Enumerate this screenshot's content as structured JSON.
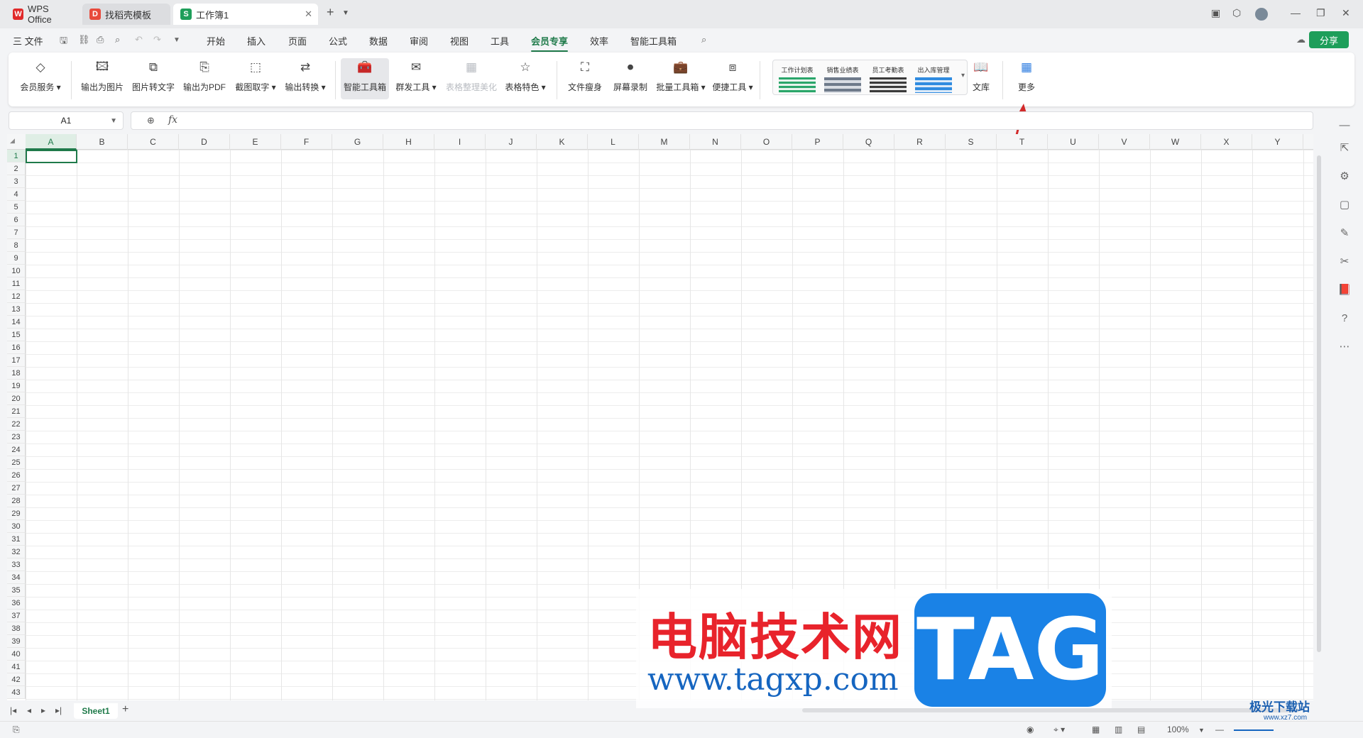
{
  "titlebar": {
    "tabs": [
      {
        "label": "WPS Office",
        "icon": "wps-logo-icon"
      },
      {
        "label": "找稻壳模板",
        "icon": "docer-icon"
      },
      {
        "label": "工作簿1",
        "icon": "spreadsheet-icon"
      }
    ]
  },
  "menubar": {
    "file_label": "三 文件",
    "items": [
      "开始",
      "插入",
      "页面",
      "公式",
      "数据",
      "审阅",
      "视图",
      "工具",
      "会员专享",
      "效率",
      "智能工具箱"
    ],
    "active": "会员专享",
    "share_label": "分享"
  },
  "ribbon": {
    "buttons": [
      {
        "label": "会员服务",
        "icon": "diamond-icon",
        "dropdown": true
      },
      {
        "label": "输出为图片",
        "icon": "image-export-icon"
      },
      {
        "label": "图片转文字",
        "icon": "ocr-icon"
      },
      {
        "label": "输出为PDF",
        "icon": "pdf-export-icon"
      },
      {
        "label": "截图取字",
        "icon": "screenshot-text-icon",
        "dropdown": true
      },
      {
        "label": "输出转换",
        "icon": "convert-icon",
        "dropdown": true
      },
      {
        "label": "智能工具箱",
        "icon": "smart-toolbox-icon",
        "selected": true
      },
      {
        "label": "群发工具",
        "icon": "mail-merge-icon",
        "dropdown": true
      },
      {
        "label": "表格整理美化",
        "icon": "table-beautify-icon",
        "disabled": true
      },
      {
        "label": "表格特色",
        "icon": "table-feature-icon",
        "dropdown": true
      },
      {
        "label": "文件瘦身",
        "icon": "file-slim-icon"
      },
      {
        "label": "屏幕录制",
        "icon": "screen-record-icon"
      },
      {
        "label": "批量工具箱",
        "icon": "batch-toolbox-icon",
        "dropdown": true
      },
      {
        "label": "便捷工具",
        "icon": "handy-tools-icon",
        "dropdown": true
      },
      {
        "label": "文库",
        "icon": "library-icon"
      },
      {
        "label": "更多",
        "icon": "more-apps-icon"
      }
    ],
    "templates": [
      "工作计划表",
      "销售业绩表",
      "员工考勤表",
      "出入库管理"
    ]
  },
  "formula_bar": {
    "cell_ref": "A1",
    "value": ""
  },
  "grid": {
    "columns": [
      "A",
      "B",
      "C",
      "D",
      "E",
      "F",
      "G",
      "H",
      "I",
      "J",
      "K",
      "L",
      "M",
      "N",
      "O",
      "P",
      "Q",
      "R",
      "S",
      "T",
      "U",
      "V",
      "W",
      "X",
      "Y"
    ],
    "rows": [
      "1",
      "2",
      "3",
      "4",
      "5",
      "6",
      "7",
      "8",
      "9",
      "10",
      "11",
      "12",
      "13",
      "14",
      "15",
      "16",
      "17",
      "18",
      "19",
      "20",
      "21",
      "22",
      "23",
      "24",
      "25",
      "26",
      "27",
      "28",
      "29",
      "30",
      "31",
      "32",
      "33",
      "34",
      "35",
      "36",
      "37",
      "38",
      "39",
      "40",
      "41",
      "42",
      "43"
    ],
    "active_cell": "A1"
  },
  "sheets": {
    "tabs": [
      "Sheet1"
    ],
    "add_label": "+"
  },
  "statusbar": {
    "zoom": "100%"
  },
  "watermark": {
    "cn_text": "电脑技术网",
    "url": "www.tagxp.com",
    "tag": "TAG",
    "corner_text": "极光下载站",
    "corner_small": "www.xz7.com"
  },
  "colors": {
    "accent": "#1f7a4a",
    "share_bg": "#1e9e5a",
    "arrow": "#d22a2a"
  }
}
